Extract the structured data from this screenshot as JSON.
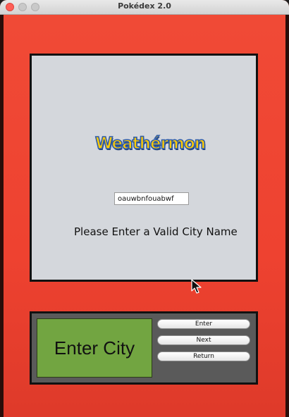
{
  "window": {
    "title": "Pokédex 2.0"
  },
  "screen": {
    "logo_text": "Weathérmon",
    "city_input_value": "oauwbnfouabwf",
    "message": "Please Enter a Valid City Name"
  },
  "controls": {
    "enter_city_label": "Enter City",
    "enter_label": "Enter",
    "next_label": "Next",
    "return_label": "Return"
  },
  "colors": {
    "body_red": "#ee4230",
    "screen_gray": "#d4d7dc",
    "panel_gray": "#5a5a5a",
    "enter_city_green": "#72a541",
    "logo_yellow": "#ffcb05",
    "logo_blue": "#2f5da8"
  },
  "icons": {
    "close": "close-traffic-light",
    "minimize": "minimize-traffic-light",
    "maximize": "maximize-traffic-light",
    "pointer": "mouse-pointer-icon"
  }
}
